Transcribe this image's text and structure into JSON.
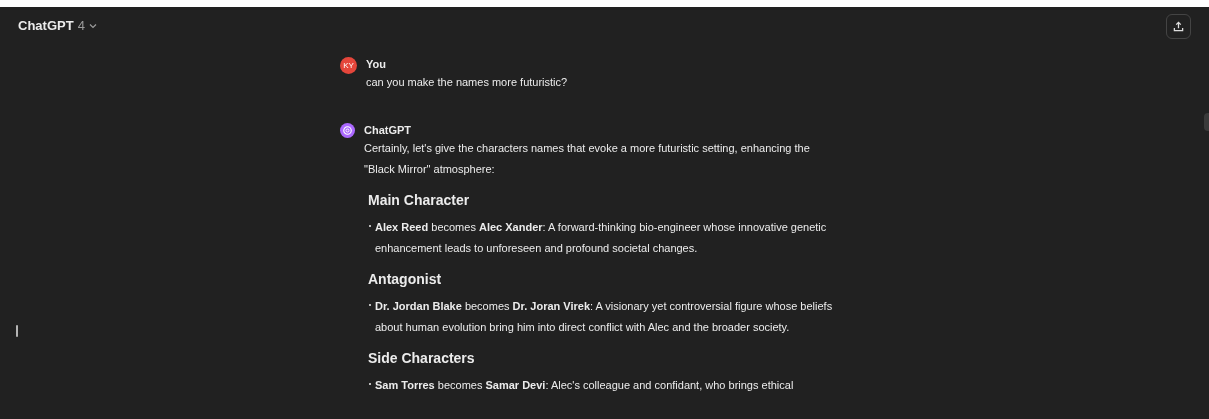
{
  "header": {
    "model_name": "ChatGPT",
    "model_version": "4"
  },
  "messages": [
    {
      "kind": "user",
      "author": "You",
      "avatar_initials": "KY",
      "blocks": [
        {
          "kind": "paragraph",
          "text": "can you make the names more futuristic?"
        }
      ]
    },
    {
      "kind": "assistant",
      "author": "ChatGPT",
      "blocks": [
        {
          "kind": "paragraph",
          "text": "Certainly, let's give the characters names that evoke a more futuristic setting, enhancing the \"Black Mirror\" atmosphere:"
        },
        {
          "kind": "heading",
          "text": "Main Character"
        },
        {
          "kind": "bullet",
          "text": "**Alex Reed** becomes **Alec Xander**: A forward-thinking bio-engineer whose innovative genetic enhancement leads to unforeseen and profound societal changes."
        },
        {
          "kind": "heading",
          "text": "Antagonist"
        },
        {
          "kind": "bullet",
          "text": "**Dr. Jordan Blake** becomes **Dr. Joran Virek**: A visionary yet controversial figure whose beliefs about human evolution bring him into direct conflict with Alec and the broader society."
        },
        {
          "kind": "heading",
          "text": "Side Characters"
        },
        {
          "kind": "bullet",
          "text": "**Sam Torres** becomes **Samar Devi**: Alec's colleague and confidant, who brings ethical"
        }
      ]
    }
  ]
}
